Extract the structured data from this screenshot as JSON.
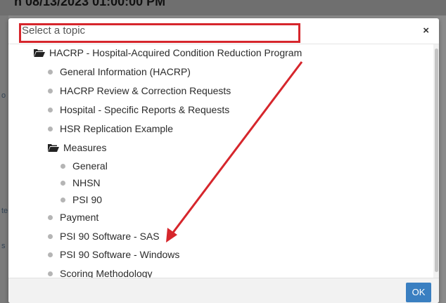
{
  "background": {
    "partial_title": "n 08/13/2023 01:00:00 PM",
    "edge_marks": [
      "o",
      "te",
      "s"
    ]
  },
  "modal": {
    "title": "Select a topic",
    "close_glyph": "×",
    "ok_label": "OK"
  },
  "tree": {
    "root": "HACRP - Hospital-Acquired Condition Reduction Program",
    "items": [
      "General Information (HACRP)",
      "HACRP Review & Correction Requests",
      "Hospital - Specific Reports & Requests",
      "HSR Replication Example"
    ],
    "measures_folder": "Measures",
    "measures_items": [
      "General",
      "NHSN",
      "PSI 90"
    ],
    "bottom_items": [
      "Payment",
      "PSI 90 Software - SAS",
      "PSI 90 Software - Windows",
      "Scoring Methodology"
    ]
  },
  "colors": {
    "annotation_red": "#d6262c",
    "ok_blue": "#3a7fc1"
  }
}
